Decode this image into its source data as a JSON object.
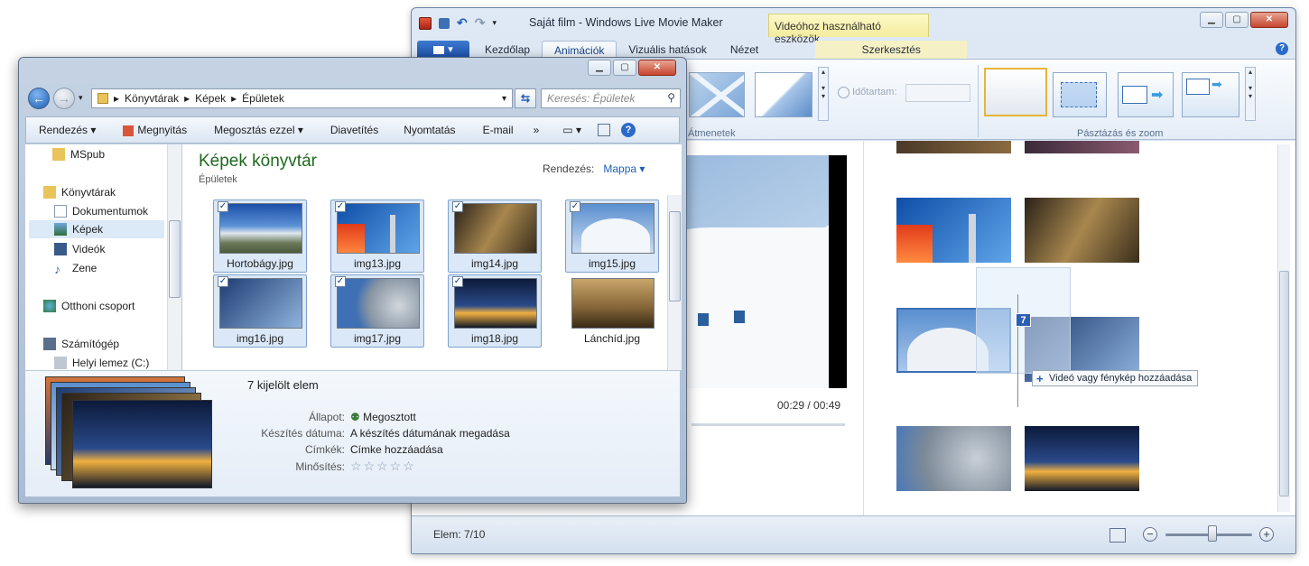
{
  "moviemaker": {
    "title": "Saját film - Windows Live Movie Maker",
    "context_tab_header": "Videóhoz használható eszközök",
    "app_menu_label": "▾",
    "tabs": [
      "Kezdőlap",
      "Animációk",
      "Vizuális hatások",
      "Nézet",
      "Szerkesztés"
    ],
    "ribbon": {
      "group_transitions": "Átmenetek",
      "duration_label": "Időtartam:",
      "group_panzoom": "Pásztázás és zoom"
    },
    "timecode": "00:29 / 00:49",
    "drag_count": "7",
    "add_tooltip": "Videó vagy fénykép hozzáadása",
    "status": "Elem: 7/10"
  },
  "explorer": {
    "address": [
      "Könyvtárak",
      "Képek",
      "Épületek"
    ],
    "search_placeholder": "Keresés: Épületek",
    "commands": [
      "Rendezés ▾",
      "Megnyitás",
      "Megosztás ezzel ▾",
      "Diavetítés",
      "Nyomtatás",
      "E-mail",
      "»"
    ],
    "nav": {
      "mspub": "MSpub",
      "libraries": "Könyvtárak",
      "documents": "Dokumentumok",
      "pictures": "Képek",
      "videos": "Videók",
      "music": "Zene",
      "homegroup": "Otthoni csoport",
      "computer": "Számítógép",
      "local_disk": "Helyi lemez (C:)"
    },
    "library_title": "Képek könyvtár",
    "library_sub": "Épületek",
    "arrange_label": "Rendezés:",
    "arrange_value": "Mappa ▾",
    "files": [
      {
        "name": "Hortobágy.jpg",
        "checked": true
      },
      {
        "name": "img13.jpg",
        "checked": true
      },
      {
        "name": "img14.jpg",
        "checked": true
      },
      {
        "name": "img15.jpg",
        "checked": true
      },
      {
        "name": "img16.jpg",
        "checked": true
      },
      {
        "name": "img17.jpg",
        "checked": true
      },
      {
        "name": "img18.jpg",
        "checked": true
      },
      {
        "name": "Lánchíd.jpg",
        "checked": false
      }
    ],
    "details": {
      "selected_count": "7 kijelölt elem",
      "state_label": "Állapot:",
      "state_value": "Megosztott",
      "date_label": "Készítés dátuma:",
      "date_value": "A készítés dátumának megadása",
      "tags_label": "Címkék:",
      "tags_value": "Címke hozzáadása",
      "rating_label": "Minősítés:",
      "rating_value": "☆☆☆☆☆"
    }
  },
  "colors": {
    "accent_blue": "#2a5fb5",
    "library_green": "#1e6a1e",
    "context_tab_yellow": "#f3eb9c"
  }
}
